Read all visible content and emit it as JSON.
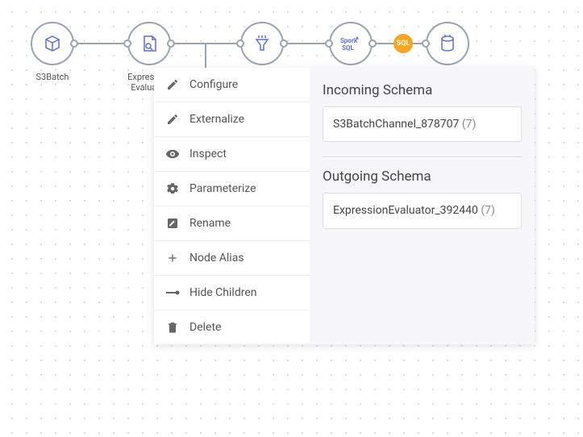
{
  "nodes": [
    {
      "label": "S3Batch"
    },
    {
      "label": "Expression\nEvaluator"
    }
  ],
  "badge": "SQL",
  "menu": {
    "items": [
      {
        "label": "Configure"
      },
      {
        "label": "Externalize"
      },
      {
        "label": "Inspect"
      },
      {
        "label": "Parameterize"
      },
      {
        "label": "Rename"
      },
      {
        "label": "Node Alias"
      },
      {
        "label": "Hide Children"
      },
      {
        "label": "Delete"
      }
    ]
  },
  "schema": {
    "incoming_title": "Incoming Schema",
    "incoming_name": "S3BatchChannel_878707",
    "incoming_count": "(7)",
    "outgoing_title": "Outgoing Schema",
    "outgoing_name": "ExpressionEvaluator_392440",
    "outgoing_count": "(7)"
  }
}
